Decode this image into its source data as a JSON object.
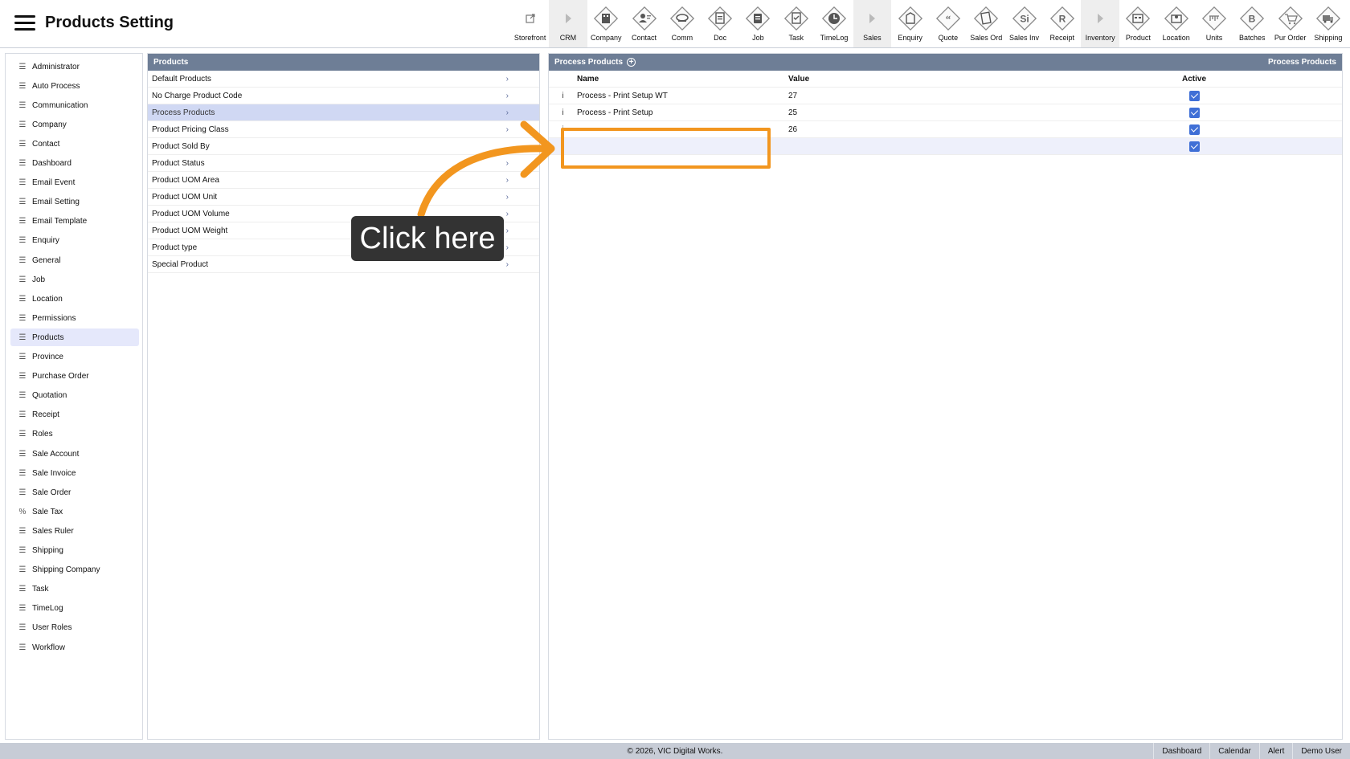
{
  "header": {
    "title": "Products Setting",
    "toolbar": [
      {
        "label": "Storefront",
        "icon": "external-link-icon"
      },
      {
        "label": "CRM",
        "icon": "caret-right-icon"
      },
      {
        "label": "Company",
        "icon": "company-icon"
      },
      {
        "label": "Contact",
        "icon": "contact-icon"
      },
      {
        "label": "Comm",
        "icon": "comm-icon"
      },
      {
        "label": "Doc",
        "icon": "doc-icon"
      },
      {
        "label": "Job",
        "icon": "job-icon"
      },
      {
        "label": "Task",
        "icon": "task-icon"
      },
      {
        "label": "TimeLog",
        "icon": "clock-icon"
      },
      {
        "label": "Sales",
        "icon": "caret-right-icon"
      },
      {
        "label": "Enquiry",
        "icon": "enquiry-icon"
      },
      {
        "label": "Quote",
        "icon": "quote-icon"
      },
      {
        "label": "Sales Ord",
        "icon": "sales-order-icon"
      },
      {
        "label": "Sales Inv",
        "icon": "sales-invoice-icon",
        "glyph": "Si"
      },
      {
        "label": "Receipt",
        "icon": "receipt-icon",
        "glyph": "R"
      },
      {
        "label": "Inventory",
        "icon": "caret-right-icon"
      },
      {
        "label": "Product",
        "icon": "product-icon"
      },
      {
        "label": "Location",
        "icon": "location-icon"
      },
      {
        "label": "Units",
        "icon": "units-icon"
      },
      {
        "label": "Batches",
        "icon": "batches-icon",
        "glyph": "B"
      },
      {
        "label": "Pur Order",
        "icon": "cart-icon"
      },
      {
        "label": "Shipping",
        "icon": "truck-icon"
      }
    ]
  },
  "sidebar": {
    "items": [
      {
        "label": "Administrator",
        "icon": "list-icon"
      },
      {
        "label": "Auto Process",
        "icon": "list-icon"
      },
      {
        "label": "Communication",
        "icon": "list-icon"
      },
      {
        "label": "Company",
        "icon": "list-icon"
      },
      {
        "label": "Contact",
        "icon": "list-icon"
      },
      {
        "label": "Dashboard",
        "icon": "list-icon"
      },
      {
        "label": "Email Event",
        "icon": "list-icon"
      },
      {
        "label": "Email Setting",
        "icon": "list-icon"
      },
      {
        "label": "Email Template",
        "icon": "list-icon"
      },
      {
        "label": "Enquiry",
        "icon": "list-icon"
      },
      {
        "label": "General",
        "icon": "list-icon"
      },
      {
        "label": "Job",
        "icon": "list-icon"
      },
      {
        "label": "Location",
        "icon": "list-icon"
      },
      {
        "label": "Permissions",
        "icon": "list-icon"
      },
      {
        "label": "Products",
        "icon": "list-icon",
        "active": true
      },
      {
        "label": "Province",
        "icon": "list-icon"
      },
      {
        "label": "Purchase Order",
        "icon": "list-icon"
      },
      {
        "label": "Quotation",
        "icon": "list-icon"
      },
      {
        "label": "Receipt",
        "icon": "list-icon"
      },
      {
        "label": "Roles",
        "icon": "list-icon"
      },
      {
        "label": "Sale Account",
        "icon": "list-icon"
      },
      {
        "label": "Sale Invoice",
        "icon": "list-icon"
      },
      {
        "label": "Sale Order",
        "icon": "list-icon"
      },
      {
        "label": "Sale Tax",
        "icon": "percent-icon"
      },
      {
        "label": "Sales Ruler",
        "icon": "list-icon"
      },
      {
        "label": "Shipping",
        "icon": "list-icon"
      },
      {
        "label": "Shipping Company",
        "icon": "list-icon"
      },
      {
        "label": "Task",
        "icon": "list-icon"
      },
      {
        "label": "TimeLog",
        "icon": "list-icon"
      },
      {
        "label": "User Roles",
        "icon": "list-icon"
      },
      {
        "label": "Workflow",
        "icon": "list-icon"
      }
    ]
  },
  "middle": {
    "title": "Products",
    "items": [
      {
        "label": "Default Products"
      },
      {
        "label": "No Charge Product Code"
      },
      {
        "label": "Process Products",
        "active": true
      },
      {
        "label": "Product Pricing Class"
      },
      {
        "label": "Product Sold By"
      },
      {
        "label": "Product Status"
      },
      {
        "label": "Product UOM Area"
      },
      {
        "label": "Product UOM Unit"
      },
      {
        "label": "Product UOM Volume"
      },
      {
        "label": "Product UOM Weight"
      },
      {
        "label": "Product type"
      },
      {
        "label": "Special Product"
      }
    ]
  },
  "right": {
    "title": "Process Products",
    "title_right": "Process Products",
    "columns": {
      "name": "Name",
      "value": "Value",
      "active": "Active"
    },
    "rows": [
      {
        "info": "i",
        "name": "Process - Print Setup WT",
        "value": "27",
        "active": true
      },
      {
        "info": "i",
        "name": "Process - Print Setup",
        "value": "25",
        "active": true
      },
      {
        "info": "i",
        "name": "",
        "value": "26",
        "active": true
      }
    ],
    "new_row": {
      "name": "",
      "value": "",
      "active": true
    }
  },
  "annotation": {
    "callout": "Click here",
    "color": "#f2961f"
  },
  "footer": {
    "copyright": "© 2026, VIC Digital Works.",
    "links": [
      "Dashboard",
      "Calendar",
      "Alert",
      "Demo User"
    ]
  }
}
